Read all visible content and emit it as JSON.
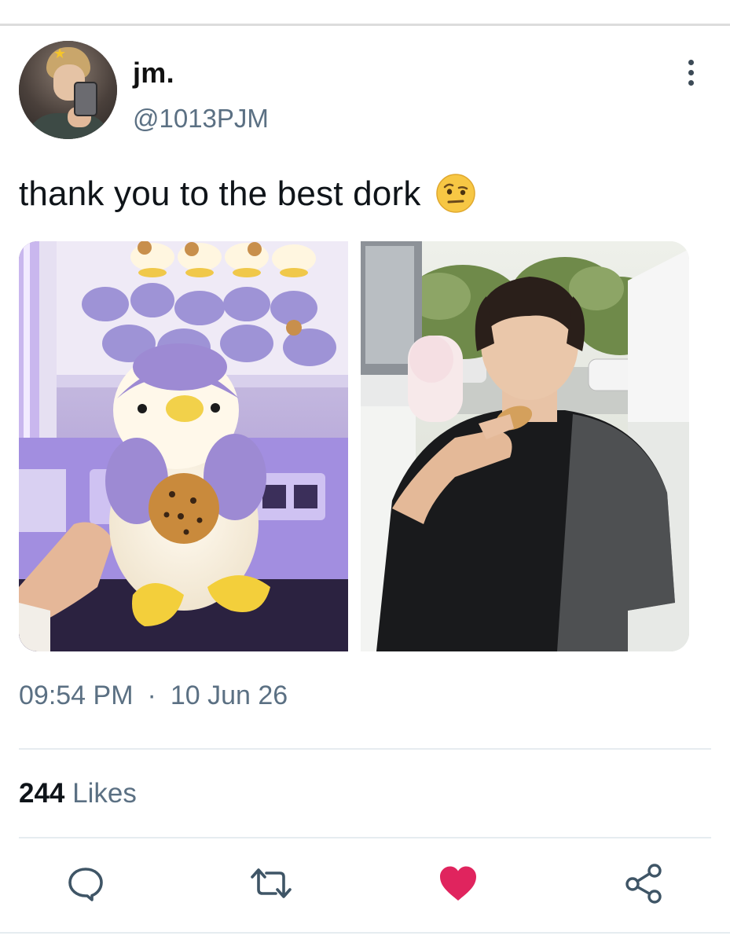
{
  "user": {
    "display_name": "jm.",
    "handle": "@1013PJM",
    "avatar_icon": "profile-photo"
  },
  "tweet": {
    "text": "thank you to the best dork",
    "emoji": "face-with-raised-eyebrow",
    "time": "09:54 PM",
    "separator": "·",
    "date": "10 Jun 26"
  },
  "stats": {
    "likes_count": "244",
    "likes_label": "Likes"
  },
  "actions": {
    "reply_icon": "reply-icon",
    "retweet_icon": "retweet-icon",
    "like_icon": "heart-icon",
    "share_icon": "share-icon",
    "like_color": "#e0245e"
  },
  "media": [
    {
      "description_icon": "plush-photo"
    },
    {
      "description_icon": "person-photo"
    }
  ]
}
